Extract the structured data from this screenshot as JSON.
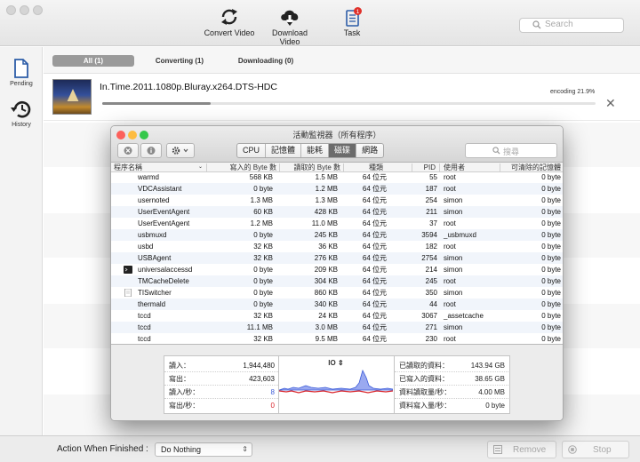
{
  "colors": {
    "am_red": "#fc605b",
    "am_yellow": "#fdbc40",
    "am_green": "#34c84a",
    "io_read": "#3a5ad8",
    "io_write": "#d8232a",
    "badge": "#e0312a"
  },
  "toolbar": {
    "convert_label": "Convert Video",
    "download_label": "Download Video",
    "task_label": "Task",
    "task_badge": "1",
    "search_placeholder": "Search"
  },
  "sidebar": {
    "pending_label": "Pending",
    "history_label": "History"
  },
  "tabs": [
    {
      "label": "All (1)",
      "active": true
    },
    {
      "label": "Converting (1)",
      "active": false
    },
    {
      "label": "Downloading (0)",
      "active": false
    }
  ],
  "job": {
    "title": "In.Time.2011.1080p.Bluray.x264.DTS-HDC",
    "status": "encoding 21.9%",
    "progress": 0.219
  },
  "bottom": {
    "action_label": "Action When Finished :",
    "action_value": "Do Nothing",
    "remove_label": "Remove",
    "stop_label": "Stop"
  },
  "activity_monitor": {
    "title": "活動監視器（所有程序）",
    "tabs": [
      {
        "label": "CPU",
        "active": false
      },
      {
        "label": "記憶體",
        "active": false
      },
      {
        "label": "能耗",
        "active": false
      },
      {
        "label": "磁碟",
        "active": true
      },
      {
        "label": "網路",
        "active": false
      }
    ],
    "search_placeholder": "搜尋",
    "columns": {
      "name": "程序名稱",
      "written": "寫入的 Byte 數",
      "read": "讀取的 Byte 數",
      "kind": "種類",
      "pid": "PID",
      "user": "使用者",
      "purgeable": "可清除的記憶體"
    },
    "rows": [
      {
        "name": "warmd",
        "written": "568 KB",
        "read": "1.5 MB",
        "kind": "64 位元",
        "pid": "55",
        "user": "root",
        "purgeable": "0 byte",
        "icon": ""
      },
      {
        "name": "VDCAssistant",
        "written": "0 byte",
        "read": "1.2 MB",
        "kind": "64 位元",
        "pid": "187",
        "user": "root",
        "purgeable": "0 byte",
        "icon": ""
      },
      {
        "name": "usernoted",
        "written": "1.3 MB",
        "read": "1.3 MB",
        "kind": "64 位元",
        "pid": "254",
        "user": "simon",
        "purgeable": "0 byte",
        "icon": ""
      },
      {
        "name": "UserEventAgent",
        "written": "60 KB",
        "read": "428 KB",
        "kind": "64 位元",
        "pid": "211",
        "user": "simon",
        "purgeable": "0 byte",
        "icon": ""
      },
      {
        "name": "UserEventAgent",
        "written": "1.2 MB",
        "read": "11.0 MB",
        "kind": "64 位元",
        "pid": "37",
        "user": "root",
        "purgeable": "0 byte",
        "icon": ""
      },
      {
        "name": "usbmuxd",
        "written": "0 byte",
        "read": "245 KB",
        "kind": "64 位元",
        "pid": "3594",
        "user": "_usbmuxd",
        "purgeable": "0 byte",
        "icon": ""
      },
      {
        "name": "usbd",
        "written": "32 KB",
        "read": "36 KB",
        "kind": "64 位元",
        "pid": "182",
        "user": "root",
        "purgeable": "0 byte",
        "icon": ""
      },
      {
        "name": "USBAgent",
        "written": "32 KB",
        "read": "276 KB",
        "kind": "64 位元",
        "pid": "2754",
        "user": "simon",
        "purgeable": "0 byte",
        "icon": ""
      },
      {
        "name": "universalaccessd",
        "written": "0 byte",
        "read": "209 KB",
        "kind": "64 位元",
        "pid": "214",
        "user": "simon",
        "purgeable": "0 byte",
        "icon": "terminal-icon"
      },
      {
        "name": "TMCacheDelete",
        "written": "0 byte",
        "read": "304 KB",
        "kind": "64 位元",
        "pid": "245",
        "user": "root",
        "purgeable": "0 byte",
        "icon": ""
      },
      {
        "name": "TISwitcher",
        "written": "0 byte",
        "read": "860 KB",
        "kind": "64 位元",
        "pid": "350",
        "user": "simon",
        "purgeable": "0 byte",
        "icon": "document-icon"
      },
      {
        "name": "thermald",
        "written": "0 byte",
        "read": "340 KB",
        "kind": "64 位元",
        "pid": "44",
        "user": "root",
        "purgeable": "0 byte",
        "icon": ""
      },
      {
        "name": "tccd",
        "written": "32 KB",
        "read": "24 KB",
        "kind": "64 位元",
        "pid": "3067",
        "user": "_assetcache",
        "purgeable": "0 byte",
        "icon": ""
      },
      {
        "name": "tccd",
        "written": "11.1 MB",
        "read": "3.0 MB",
        "kind": "64 位元",
        "pid": "271",
        "user": "simon",
        "purgeable": "0 byte",
        "icon": ""
      },
      {
        "name": "tccd",
        "written": "32 KB",
        "read": "9.5 MB",
        "kind": "64 位元",
        "pid": "230",
        "user": "root",
        "purgeable": "0 byte",
        "icon": ""
      }
    ],
    "stats_left": [
      {
        "label": "讀入：",
        "value": "1,944,480",
        "color": "#111"
      },
      {
        "label": "寫出：",
        "value": "423,603",
        "color": "#111"
      },
      {
        "label": "讀入/秒：",
        "value": "8",
        "color": "#3a5ad8"
      },
      {
        "label": "寫出/秒：",
        "value": "0",
        "color": "#d8232a"
      }
    ],
    "graph_label": "IO",
    "stats_right": [
      {
        "label": "已讀取的資料：",
        "value": "143.94 GB"
      },
      {
        "label": "已寫入的資料：",
        "value": "38.65 GB"
      },
      {
        "label": "資料讀取量/秒：",
        "value": "4.00 MB"
      },
      {
        "label": "資料寫入量/秒：",
        "value": "0 byte"
      }
    ]
  }
}
